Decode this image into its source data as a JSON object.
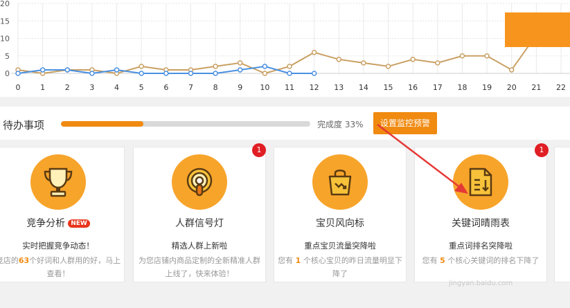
{
  "chart_data": {
    "type": "line",
    "x": [
      0,
      1,
      2,
      3,
      4,
      5,
      6,
      7,
      8,
      9,
      10,
      11,
      12,
      13,
      14,
      15,
      16,
      17,
      18,
      19,
      20,
      21,
      22
    ],
    "xlim": [
      0,
      22
    ],
    "ylim": [
      0,
      20
    ],
    "y_ticks": [
      "0",
      "5",
      "10",
      "15",
      "20"
    ],
    "x_ticks": [
      "0",
      "1",
      "2",
      "3",
      "4",
      "5",
      "6",
      "7",
      "8",
      "9",
      "10",
      "11",
      "12",
      "13",
      "14",
      "15",
      "16",
      "17",
      "18",
      "19",
      "20",
      "21",
      "22"
    ],
    "grid": true,
    "series": [
      {
        "color": "#c9a063",
        "values": [
          1,
          0,
          1,
          1,
          0,
          2,
          1,
          1,
          2,
          3,
          0,
          2,
          6,
          4,
          3,
          2,
          4,
          3,
          5,
          5,
          1,
          11,
          null
        ]
      },
      {
        "color": "#4a90e2",
        "values": [
          0,
          1,
          1,
          0,
          1,
          0,
          0,
          0,
          0,
          1,
          2,
          0,
          0,
          null,
          null,
          null,
          null,
          null,
          null,
          null,
          null,
          null,
          null
        ]
      }
    ]
  },
  "todo": {
    "title": "待办事项",
    "progress": 0.33,
    "progress_label": "完成度 33%",
    "monitor_button": "设置监控预警",
    "accent": "#f08a10"
  },
  "cards": [
    {
      "name": "竞争分析",
      "badge_new": "NEW",
      "subtitle": "实时把握竞争动态！",
      "desc_pre": "竞店的",
      "highlight": "63",
      "desc_post": "个好词和人群用的好，马上查看！",
      "icon": "trophy-icon",
      "count_badge": ""
    },
    {
      "name": "人群信号灯",
      "badge_new": "",
      "subtitle": "精选人群上新啦",
      "desc_pre": "为您店铺内商品定制的全新精准人群上线了，快来体验！",
      "highlight": "",
      "desc_post": "",
      "icon": "signal-light-icon",
      "count_badge": "1"
    },
    {
      "name": "宝贝风向标",
      "badge_new": "",
      "subtitle": "重点宝贝流量突降啦",
      "desc_pre": "您有 ",
      "highlight": "1",
      "desc_post": " 个核心宝贝的昨日流量明显下降了",
      "icon": "bag-trend-icon",
      "count_badge": ""
    },
    {
      "name": "关键词晴雨表",
      "badge_new": "",
      "subtitle": "重点词排名突降啦",
      "desc_pre": "您有 ",
      "highlight": "5",
      "desc_post": " 个核心关键词的排名下降了",
      "icon": "document-sort-icon",
      "count_badge": "1"
    }
  ],
  "watermark": "jingyan.baidu.com"
}
